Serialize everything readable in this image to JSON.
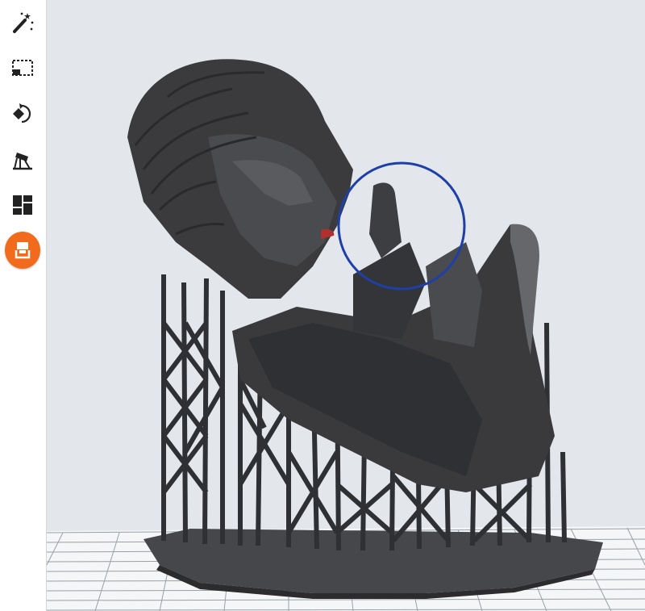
{
  "toolbar": {
    "tools": [
      {
        "name": "magic-wand",
        "active": false
      },
      {
        "name": "select-area",
        "active": false
      },
      {
        "name": "rotate",
        "active": false
      },
      {
        "name": "support-tool",
        "active": false
      },
      {
        "name": "layout",
        "active": false
      },
      {
        "name": "printer-export",
        "active": true
      }
    ]
  },
  "colors": {
    "accent": "#f26a1b",
    "viewport_bg": "#e3e7ec",
    "model": "#3a3a3c",
    "highlight_circle": "#1f3fa8",
    "build_plate_line": "#9aa0a6"
  },
  "viewport": {
    "highlight_annotation": "circle"
  }
}
